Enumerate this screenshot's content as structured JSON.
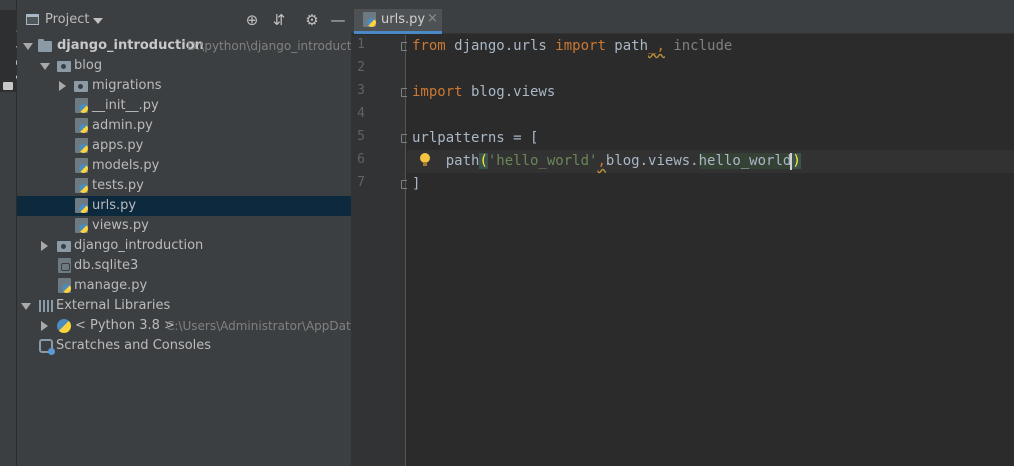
{
  "toolstrip": {
    "project_tab": "1: Project"
  },
  "project_panel": {
    "title": "Project",
    "tree": [
      {
        "label": "django_introduction",
        "path": "D:\\python\\django_introducti"
      },
      {
        "label": "blog"
      },
      {
        "label": "migrations"
      },
      {
        "label": "__init__.py"
      },
      {
        "label": "admin.py"
      },
      {
        "label": "apps.py"
      },
      {
        "label": "models.py"
      },
      {
        "label": "tests.py"
      },
      {
        "label": "urls.py"
      },
      {
        "label": "views.py"
      },
      {
        "label": "django_introduction"
      },
      {
        "label": "db.sqlite3"
      },
      {
        "label": "manage.py"
      },
      {
        "label": "External Libraries"
      },
      {
        "label": "< Python 3.8 >",
        "path": "C:\\Users\\Administrator\\AppData"
      },
      {
        "label": "Scratches and Consoles"
      }
    ]
  },
  "editor": {
    "tab_label": "urls.py",
    "tab_close": "×",
    "line_numbers": [
      "1",
      "2",
      "3",
      "4",
      "5",
      "6",
      "7"
    ],
    "code": {
      "l1_kw_from": "from",
      "l1_module": " django.urls ",
      "l1_kw_import": "import",
      "l1_name": " path",
      "l1_sep": "_,",
      "l1_unused": " include",
      "l3_kw_import": "import",
      "l3_module": " blog.views",
      "l5_text": "urlpatterns = [",
      "l6_indent": "    ",
      "l6_func": "path",
      "l6_open": "(",
      "l6_string": "'hello_world'",
      "l6_comma": ",",
      "l6_ref_prefix": "blog.views.",
      "l6_ref_name": "hello_world",
      "l6_close": ")",
      "l7_text": "]"
    }
  }
}
